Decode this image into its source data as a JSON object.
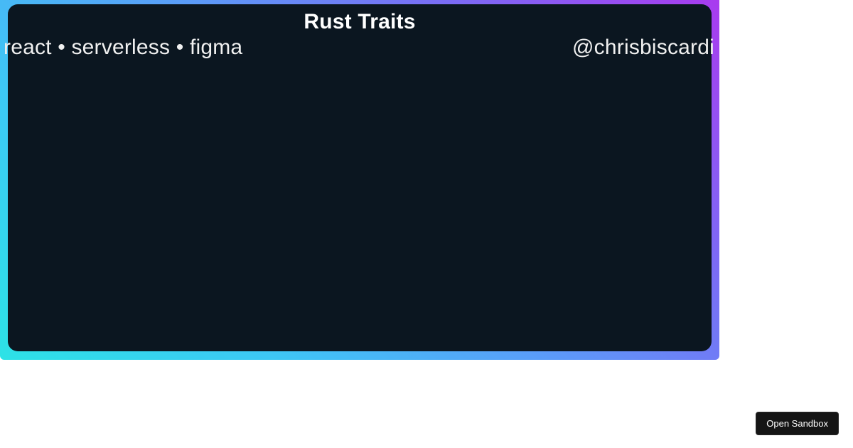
{
  "card": {
    "title": "Rust Traits",
    "tags": "react • serverless • figma",
    "handle": "@chrisbiscardi"
  },
  "controls": {
    "open_sandbox_label": "Open Sandbox"
  }
}
